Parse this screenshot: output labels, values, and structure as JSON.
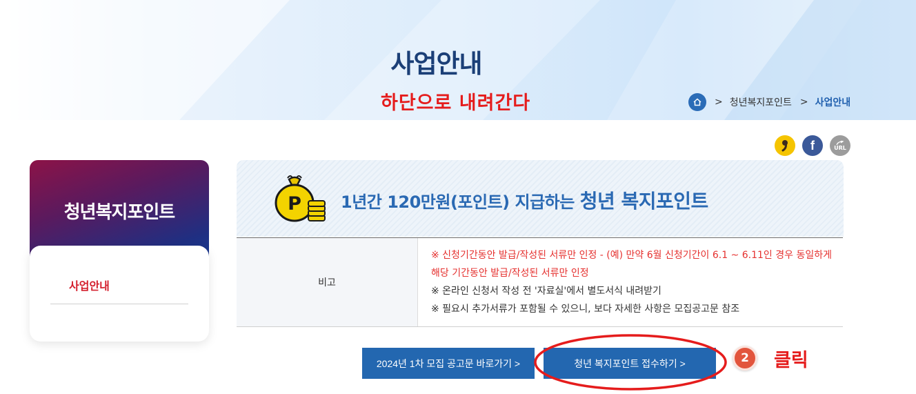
{
  "hero": {
    "title": "사업안내",
    "scroll_note": "하단으로 내려간다",
    "breadcrumb": {
      "home_icon": "home-icon",
      "separator": ">",
      "items": [
        "청년복지포인트",
        "사업안내"
      ]
    }
  },
  "share": {
    "icons": [
      "kakao-story-icon",
      "facebook-icon",
      "url-copy-icon"
    ],
    "facebook_glyph": "f",
    "url_label": "URL"
  },
  "sidebar": {
    "title": "청년복지포인트",
    "items": [
      {
        "label": "사업안내",
        "active": true
      }
    ]
  },
  "banner": {
    "icon": "money-bag-coins-icon",
    "text_prefix": "1년간 120만원(포인트) 지급하는",
    "text_highlight": "청년 복지포인트",
    "coin_letter": "P"
  },
  "table": {
    "rows": [
      {
        "header": "비고",
        "notes": [
          {
            "text": "※ 신청기간동안 발급/작성된 서류만 인정 - (예) 만약 6월 신청기간이 6.1 ~ 6.11인 경우 동일하게",
            "color": "#e5312f"
          },
          {
            "text": "해당 기간동안 발급/작성된 서류만 인정",
            "color": "#e5312f"
          },
          {
            "text": "※ 온라인 신청서 작성 전 '자료실'에서 별도서식 내려받기",
            "color": "#333333"
          },
          {
            "text": "※ 필요시 추가서류가 포함될 수 있으니, 보다 자세한 사항은 모집공고문 참조",
            "color": "#333333"
          }
        ]
      }
    ]
  },
  "buttons": {
    "notice": "2024년 1차 모집 공고문 바로가기 >",
    "apply": "청년 복지포인트 접수하기 >"
  },
  "annotation": {
    "step_number": "2",
    "click_label": "클릭",
    "highlight_color": "#e51c1c"
  },
  "colors": {
    "primary": "#2367b0",
    "title": "#1b3f77",
    "accent_red": "#d4202e"
  }
}
